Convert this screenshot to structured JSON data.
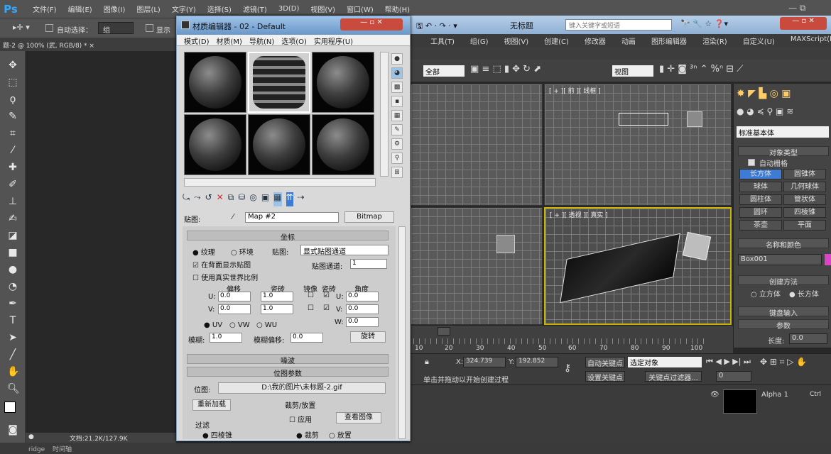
{
  "ps": {
    "logo": "Ps",
    "menus": [
      "文件(F)",
      "编辑(E)",
      "图像(I)",
      "图层(L)",
      "文字(Y)",
      "选择(S)",
      "滤镜(T)",
      "3D(D)",
      "视图(V)",
      "窗口(W)",
      "帮助(H)"
    ],
    "options": {
      "auto_select_label": "自动选择：",
      "auto_select_value": "组",
      "show_label": "显示"
    },
    "tab": "题-2 @ 100% (武, RGB/8) * ×",
    "status": {
      "doc": "文档:21.2K/127.9K"
    },
    "bottom": {
      "left": "ridge",
      "time": "时间轴"
    }
  },
  "mat": {
    "title": "材质编辑器 - 02 - Default",
    "menus": [
      "模式(D)",
      "材质(M)",
      "导航(N)",
      "选项(O)",
      "实用程序(U)"
    ],
    "map_label": "贴图:",
    "map_name": "Map #2",
    "map_type": "Bitmap",
    "coords": {
      "title": "坐标",
      "texture": "纹理",
      "environ": "环境",
      "mapping_label": "贴图:",
      "mapping_value": "显式贴图通道",
      "show_back": "在背面显示贴图",
      "channel_label": "贴图通道:",
      "channel_value": "1",
      "real_world": "使用真实世界比例",
      "h_offset": "偏移",
      "h_tiling": "瓷砖",
      "h_mirror": "镜像",
      "h_tile": "瓷砖",
      "h_angle": "角度",
      "u_label": "U:",
      "v_label": "V:",
      "w_label": "W:",
      "u_offset": "0.0",
      "u_tiling": "1.0",
      "u_angle": "0.0",
      "v_offset": "0.0",
      "v_tiling": "1.0",
      "v_angle": "0.0",
      "w_angle": "0.0",
      "uv": "UV",
      "vw": "VW",
      "wu": "WU",
      "blur_label": "模糊:",
      "blur_value": "1.0",
      "blur_offset_label": "模糊偏移:",
      "blur_offset_value": "0.0",
      "rotate": "旋转"
    },
    "noise": "噪波",
    "bitmap_params": {
      "title": "位图参数",
      "bitmap_label": "位图:",
      "bitmap_path": "D:\\我的图片\\未标题-2.gif",
      "reload": "重新加载",
      "crop_title": "裁剪/放置",
      "apply": "应用",
      "view_image": "查看图像",
      "filter": "过滤",
      "four_point": "四棱锥",
      "crop": "裁剪",
      "place": "放置"
    }
  },
  "max": {
    "title": "无标题",
    "search_placeholder": "键入关键字或短语",
    "menus": [
      "工具(T)",
      "组(G)",
      "视图(V)",
      "创建(C)",
      "修改器",
      "动画",
      "图形编辑器",
      "渲染(R)",
      "自定义(U)",
      "MAXScript(M)"
    ],
    "toolbar": {
      "filter": "全部",
      "view": "视图"
    },
    "viewports": {
      "front": "[ + ][ 前 ][ 线框 ]",
      "persp": "[ + ][ 透视 ][ 真实 ]"
    },
    "cmd": {
      "category": "标准基本体",
      "object_type": "对象类型",
      "autogrid": "自动栅格",
      "prims": [
        "长方体",
        "圆锥体",
        "球体",
        "几何球体",
        "圆柱体",
        "管状体",
        "圆环",
        "四棱锥",
        "茶壶",
        "平面"
      ],
      "name_color": "名称和颜色",
      "object_name": "Box001",
      "create_method": "创建方法",
      "cube": "立方体",
      "box": "长方体",
      "keyboard": "键盘输入",
      "params": "参数",
      "length_label": "长度:",
      "length_value": "0.0"
    },
    "timeline": {
      "ticks": [
        "10",
        "20",
        "30",
        "40",
        "50",
        "60",
        "70",
        "80",
        "90",
        "100"
      ]
    },
    "status": {
      "x_label": "X:",
      "x_value": "324.739",
      "y_label": "Y:",
      "y_value": "192.852",
      "auto_key": "自动关键点",
      "selected": "选定对象",
      "set_key": "设置关键点",
      "key_filter": "关键点过滤器...",
      "prompt": "单击并拖动以开始创建过程",
      "frame": "0"
    }
  },
  "layers": {
    "channel": "Alpha 1",
    "shortcut": "Ctrl"
  }
}
